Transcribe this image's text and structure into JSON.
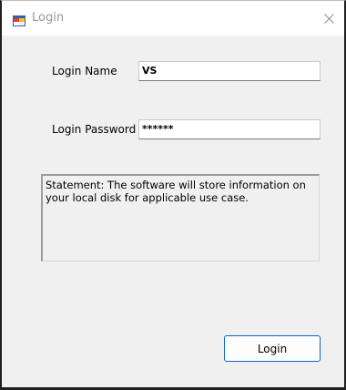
{
  "window": {
    "title": "Login"
  },
  "form": {
    "login_name_label": "Login Name",
    "login_name_value": "VS",
    "login_password_label": "Login Password",
    "login_password_value": "******",
    "statement_text": "Statement: The software will store information on your local disk for applicable use case.",
    "login_button_label": "Login"
  },
  "icons": {
    "app": "app-window-icon",
    "close": "close-icon"
  },
  "colors": {
    "window_background": "#f0f0f0",
    "titlebar_background": "#ffffff",
    "button_border": "#0a64c8"
  }
}
